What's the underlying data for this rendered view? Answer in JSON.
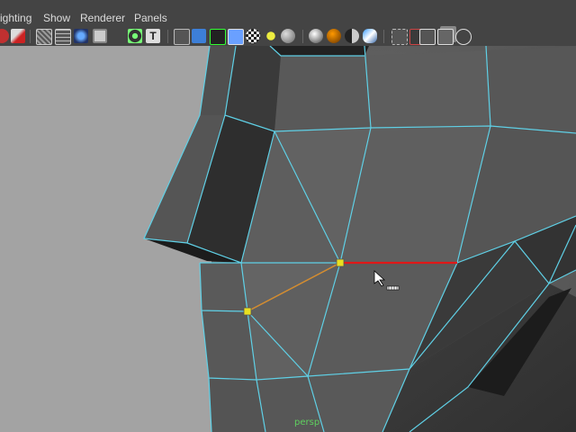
{
  "menus": {
    "lighting": "ighting",
    "show": "Show",
    "renderer": "Renderer",
    "panels": "Panels"
  },
  "toolbar": {
    "icons": [
      "select-camera-icon",
      "paint-icon",
      "wireframe-icon",
      "smooth-shade-icon",
      "texture-icon",
      "light-icon",
      "isolate-icon",
      "text-icon",
      "bounding-box-icon",
      "shaded-cube-icon",
      "xray-cube-icon",
      "default-material-icon",
      "checker-icon",
      "sphere-icon",
      "high-quality-icon",
      "light-bulb-icon",
      "shadow-icon",
      "ambient-occlusion-icon",
      "motion-blur-icon",
      "anti-alias-icon",
      "selection-highlight-icon",
      "cube-outline-icon",
      "two-cubes-icon",
      "connect-icon"
    ]
  },
  "viewport": {
    "camera_label": "persp"
  },
  "colors": {
    "wire": "#5fd0e6",
    "selected_edge": "#e01818",
    "preview_edge": "#d88a2a",
    "vertex": "#e8e020",
    "camera_label": "#5fd05f"
  }
}
